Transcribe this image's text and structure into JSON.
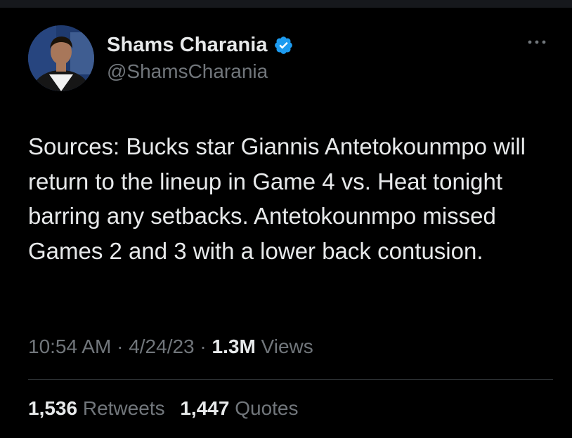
{
  "author": {
    "display_name": "Shams Charania",
    "handle": "@ShamsCharania",
    "verified_badge_color": "#1d9bf0",
    "avatar_icon": "profile-photo",
    "verified_icon": "verified-badge-icon"
  },
  "tweet": {
    "text": "Sources: Bucks star Giannis Antetokounmpo will return to the lineup in Game 4 vs. Heat tonight barring any setbacks. Antetokounmpo missed Games 2 and 3 with a lower back contusion."
  },
  "meta": {
    "time": "10:54 AM",
    "separator": "·",
    "date": "4/24/23",
    "views_count": "1.3M",
    "views_label": "Views"
  },
  "stats": {
    "retweets_count": "1,536",
    "retweets_label": "Retweets",
    "quotes_count": "1,447",
    "quotes_label": "Quotes"
  },
  "colors": {
    "background": "#000000",
    "primary_text": "#e7e9ea",
    "secondary_text": "#71767b",
    "divider": "#2f3336"
  }
}
